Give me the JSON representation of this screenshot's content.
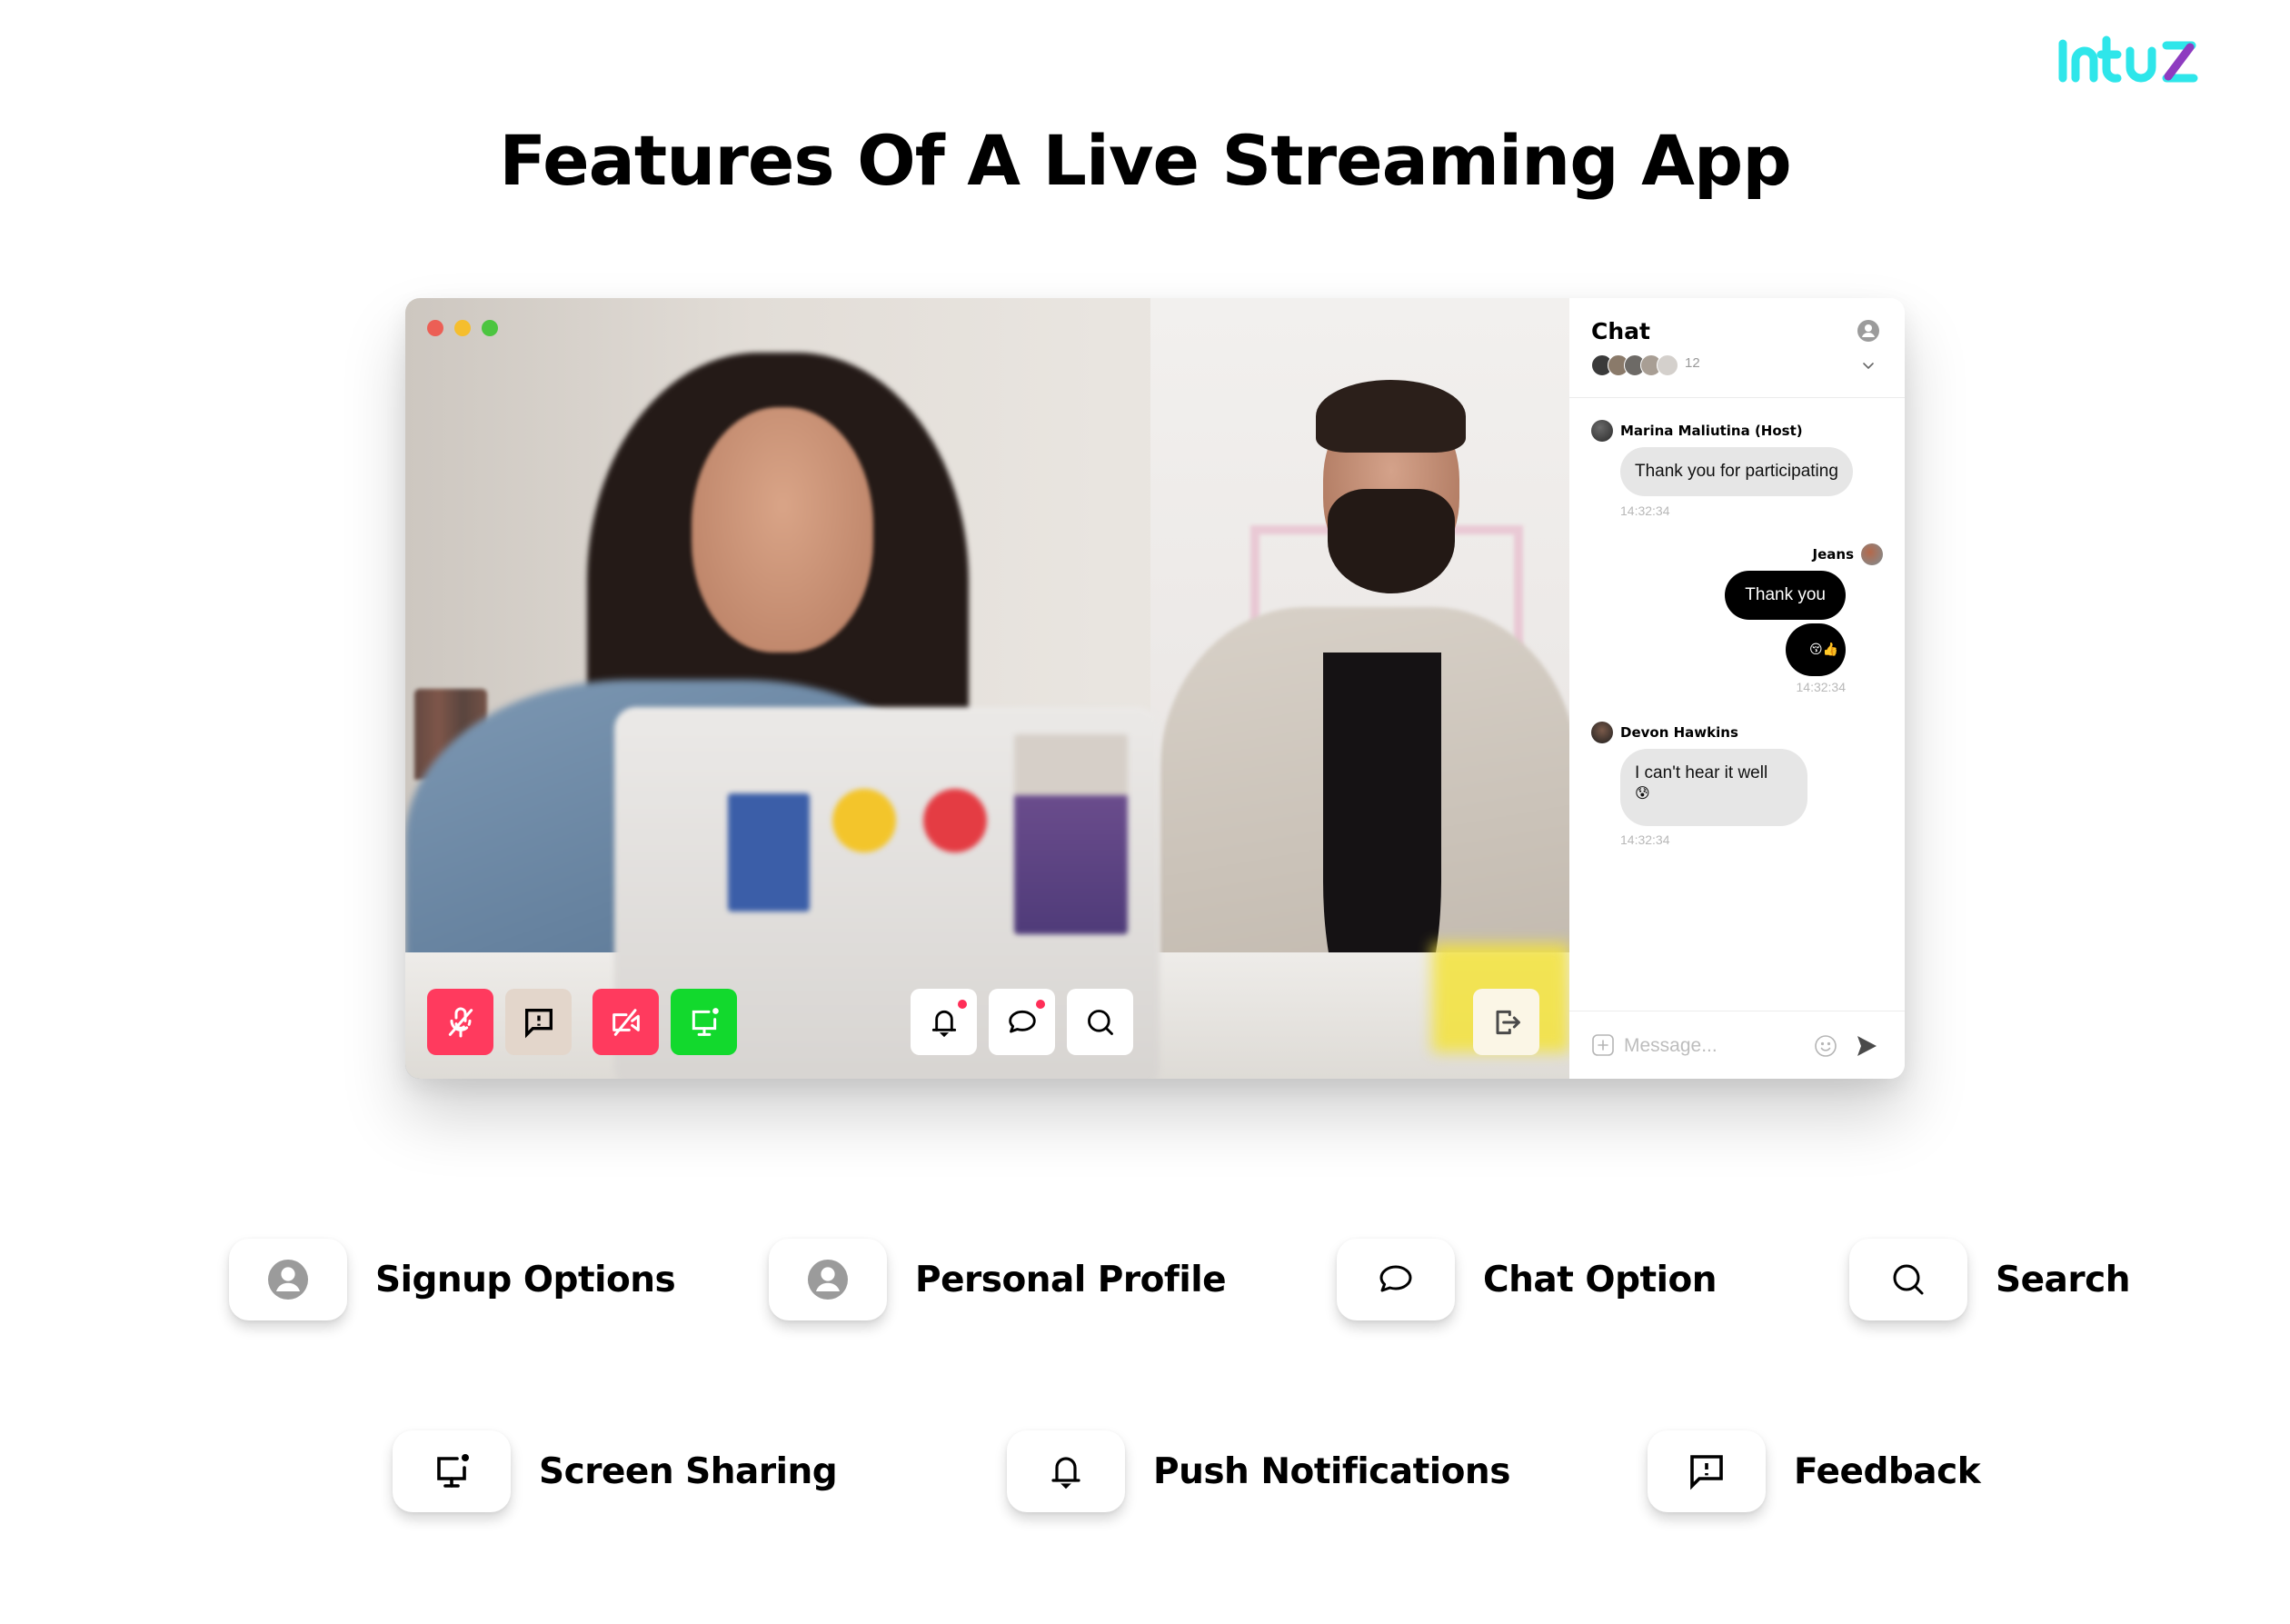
{
  "brand": {
    "logo_text": "intuz",
    "colors": {
      "logo_cyan": "#2ee6ea",
      "logo_purple": "#8e3bc0"
    }
  },
  "page": {
    "title": "Features Of A Live Streaming App"
  },
  "window": {
    "traffic_lights": [
      {
        "name": "close",
        "color": "#ec5f55"
      },
      {
        "name": "minimize",
        "color": "#f5be2e"
      },
      {
        "name": "maximize",
        "color": "#4cc540"
      }
    ],
    "video": {
      "description": "Live video feed: two people seated at a table behind a laptop with stickers",
      "controls_left": [
        {
          "name": "mute-microphone",
          "icon": "microphone-off-icon",
          "bg": "#ff3a5e",
          "fg": "#ffffff"
        },
        {
          "name": "feedback",
          "icon": "feedback-icon",
          "bg": "#e3d6cb",
          "fg": "#000000"
        },
        {
          "name": "camera-off",
          "icon": "camera-off-icon",
          "bg": "#ff3a5e",
          "fg": "#ffffff"
        },
        {
          "name": "screen-share",
          "icon": "screen-share-icon",
          "bg": "#12d92d",
          "fg": "#ffffff"
        }
      ],
      "controls_center": [
        {
          "name": "notifications",
          "icon": "bell-icon",
          "has_badge": true
        },
        {
          "name": "chat",
          "icon": "chat-bubble-icon",
          "has_badge": true
        },
        {
          "name": "search",
          "icon": "search-icon",
          "has_badge": false
        }
      ],
      "controls_right": [
        {
          "name": "leave",
          "icon": "exit-icon",
          "bg": "#fbf6e6"
        }
      ],
      "badge_color": "#ff2e57"
    },
    "chat": {
      "title": "Chat",
      "participant_count": "12",
      "messages": [
        {
          "author": "Marina Maliutina (Host)",
          "text": "Thank you for participating",
          "time": "14:32:34",
          "direction": "incoming"
        },
        {
          "author": "Jeans",
          "text": "Thank you",
          "emoji": "😚👍",
          "time": "14:32:34",
          "direction": "outgoing"
        },
        {
          "author": "Devon Hawkins",
          "text": "I can't hear it well",
          "emoji": "😰",
          "time": "14:32:34",
          "direction": "incoming"
        }
      ],
      "composer": {
        "placeholder": "Message..."
      }
    }
  },
  "features": [
    {
      "label": "Signup Options",
      "icon": "user-circle-icon"
    },
    {
      "label": "Personal Profile",
      "icon": "user-circle-icon"
    },
    {
      "label": "Chat Option",
      "icon": "chat-bubble-icon"
    },
    {
      "label": "Search",
      "icon": "search-icon"
    },
    {
      "label": "Screen Sharing",
      "icon": "screen-share-icon"
    },
    {
      "label": "Push Notifications",
      "icon": "bell-icon"
    },
    {
      "label": "Feedback",
      "icon": "feedback-icon"
    }
  ]
}
